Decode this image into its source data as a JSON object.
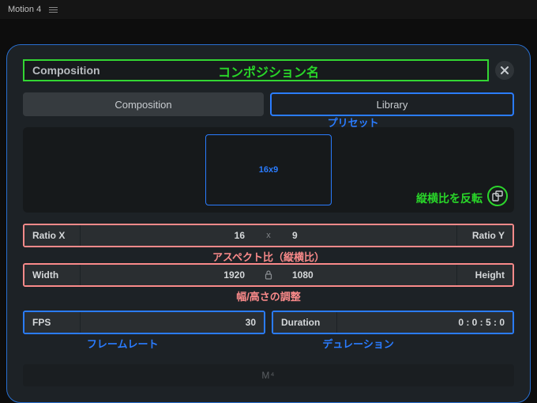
{
  "app": {
    "title": "Motion 4"
  },
  "title": {
    "text": "Composition",
    "highlight": "コンポジション名"
  },
  "tabs": {
    "composition": "Composition",
    "library": "Library",
    "highlight": "プリセット"
  },
  "aspect": {
    "preview_label": "16x9",
    "flip_highlight": "縦横比を反転"
  },
  "ratio": {
    "label_x": "Ratio X",
    "val_x": "16",
    "mid": "x",
    "val_y": "9",
    "label_y": "Ratio Y",
    "highlight": "アスペクト比（縦横比）"
  },
  "size": {
    "label_w": "Width",
    "val_w": "1920",
    "val_h": "1080",
    "label_h": "Height",
    "highlight": "幅/高さの調整"
  },
  "fps": {
    "label": "FPS",
    "value": "30",
    "highlight": "フレームレート"
  },
  "duration": {
    "label": "Duration",
    "value": "0 : 0 : 5 : 0",
    "highlight": "デュレーション"
  },
  "footer": {
    "label": "M⁴"
  }
}
